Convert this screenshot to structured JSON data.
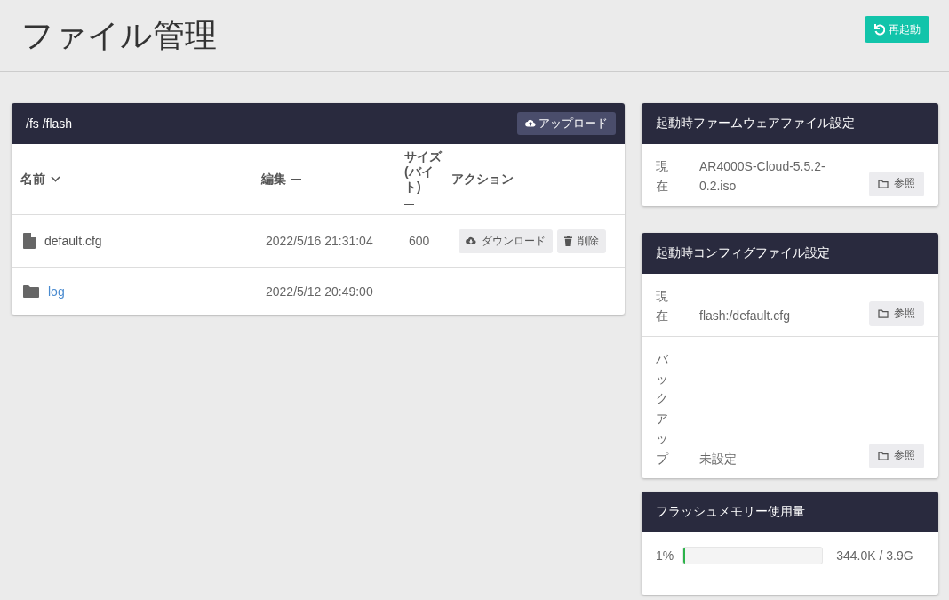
{
  "page": {
    "title": "ファイル管理",
    "restart_button": "再起動"
  },
  "file_panel": {
    "path": "/fs /flash",
    "upload_button": "アップロード",
    "columns": [
      {
        "label": "名前",
        "sortable": true,
        "sorted": true
      },
      {
        "label": "編集",
        "sortable": true,
        "sorted": false
      },
      {
        "label": "サイズ(バイト)",
        "sortable": true,
        "sorted": false
      },
      {
        "label": "アクション",
        "sortable": false
      }
    ],
    "rows": [
      {
        "kind": "file",
        "name": "default.cfg",
        "modified": "2022/5/16 21:31:04",
        "size": "600",
        "actions": [
          "ダウンロード",
          "削除"
        ]
      },
      {
        "kind": "folder",
        "name": "log",
        "modified": "2022/5/12 20:49:00",
        "actions": []
      }
    ]
  },
  "firmware_panel": {
    "title": "起動時ファームウェアファイル設定",
    "rows": [
      {
        "label": "現在",
        "value": "AR4000S-Cloud-5.5.2-0.2.iso",
        "button": "参照"
      }
    ]
  },
  "config_panel": {
    "title": "起動時コンフィグファイル設定",
    "rows": [
      {
        "label": "現在",
        "value": "flash:/default.cfg",
        "button": "参照"
      },
      {
        "label": "バックアップ",
        "value": "未設定",
        "button": "参照"
      }
    ]
  },
  "flash_panel": {
    "title": "フラッシュメモリー使用量",
    "percent": "1%",
    "level": 0.01,
    "usage": "344.0K / 3.9G"
  }
}
